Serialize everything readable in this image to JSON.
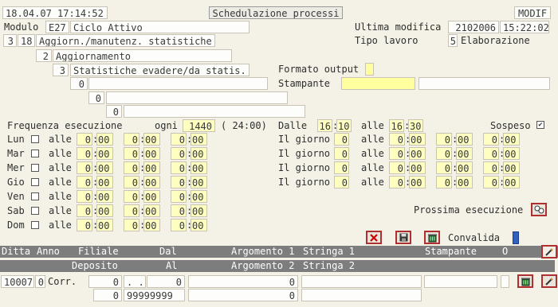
{
  "header": {
    "datetime": "18.04.07 17:14:52",
    "title": "Schedulazione processi",
    "mode": "MODIF"
  },
  "modulo": {
    "label": "Modulo",
    "code": "E27",
    "name": "Ciclo Attivo"
  },
  "ultima_modifica": {
    "label": "Ultima modifica",
    "date": "2102006",
    "time": "15:22:02"
  },
  "tipo_lavoro": {
    "label": "Tipo lavoro",
    "code": "5",
    "name": "Elaborazione"
  },
  "levels": [
    {
      "n1": "3",
      "n2": "18",
      "name": "Aggiorn./manutenz. statistiche"
    },
    {
      "n": "2",
      "name": "Aggiornamento"
    },
    {
      "n": "3",
      "name": "Statistiche evadere/da statis."
    },
    {
      "n": "0"
    },
    {
      "n": "0"
    },
    {
      "n": "0"
    }
  ],
  "formato_output": {
    "label": "Formato output",
    "value": ""
  },
  "stampante": {
    "label": "Stampante",
    "value": "",
    "extra": ""
  },
  "frequenza": {
    "label": "Frequenza esecuzione",
    "ogni_label": "ogni",
    "ogni_value": "1440",
    "ogni_hint": "( 24:00)",
    "dalle_label": "Dalle",
    "dalle_h": "16",
    "dalle_m": "10",
    "alle_label": "alle",
    "alle_h": "16",
    "alle_m": "30",
    "sospeso_label": "Sospeso",
    "sospeso_mark": "✔"
  },
  "days": [
    {
      "name": "Lun",
      "alle": "alle"
    },
    {
      "name": "Mar",
      "alle": "alle"
    },
    {
      "name": "Mer",
      "alle": "alle"
    },
    {
      "name": "Gio",
      "alle": "alle"
    },
    {
      "name": "Ven",
      "alle": "alle"
    },
    {
      "name": "Sab",
      "alle": "alle"
    },
    {
      "name": "Dom",
      "alle": "alle"
    }
  ],
  "time_value": {
    "h": "0",
    "m": "00"
  },
  "giorno": {
    "label": "Il giorno",
    "value": "0",
    "alle": "alle"
  },
  "prossima_esecuzione": "Prossima esecuzione",
  "convalida": "Convalida",
  "table": {
    "row1_headers": [
      "Ditta",
      "Anno",
      "Filiale",
      "Dal",
      "Argomento 1",
      "Stringa 1",
      "Stampante",
      "O"
    ],
    "row2_headers": [
      "Deposito",
      "Al",
      "Argomento 2",
      "Stringa 2"
    ],
    "row": {
      "ditta": "10007",
      "anno": "0",
      "filiale": "Corr.",
      "deposito1": "0",
      "deposito2": "0",
      "dal": ". .",
      "dal_num": "0",
      "al": "99999999",
      "arg1": "0",
      "arg2": "0"
    }
  },
  "icons": {
    "cancel": "cancel-icon",
    "save": "save-icon",
    "delete": "trash-icon",
    "edit": "edit-icon",
    "search": "search-icon"
  }
}
